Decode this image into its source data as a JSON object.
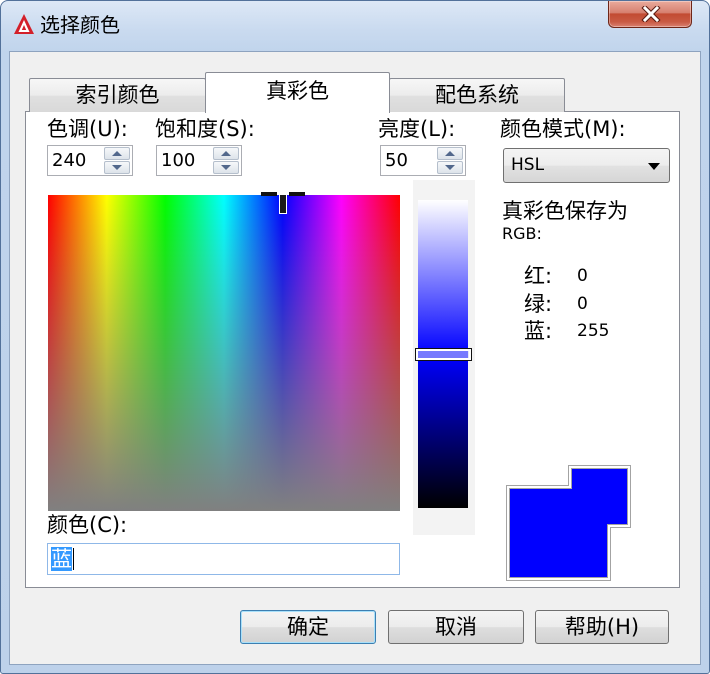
{
  "window": {
    "title": "选择颜色",
    "app_icon": "autocad-logo-icon",
    "close_icon": "close-icon"
  },
  "tabs": [
    {
      "label": "索引颜色",
      "selected": false
    },
    {
      "label": "真彩色",
      "selected": true
    },
    {
      "label": "配色系统",
      "selected": false
    }
  ],
  "true_color": {
    "hue": {
      "label": "色调(U):",
      "value": "240"
    },
    "saturation": {
      "label": "饱和度(S):",
      "value": "100"
    },
    "luminance": {
      "label": "亮度(L):",
      "value": "50"
    },
    "color_model": {
      "label": "颜色模式(M):",
      "selected": "HSL"
    },
    "stored_as": {
      "line1": "真彩色保存为",
      "line2": "RGB:"
    },
    "rgb": [
      {
        "label": "红:",
        "value": "0"
      },
      {
        "label": "绿:",
        "value": "0"
      },
      {
        "label": "蓝:",
        "value": "255"
      }
    ],
    "color_field": {
      "label": "颜色(C):",
      "value": "蓝",
      "text_selected": true
    },
    "preview": {
      "new_color": "#0000ff",
      "original_color": "#0000ff"
    }
  },
  "buttons": {
    "ok": "确定",
    "cancel": "取消",
    "help": "帮助(H)"
  },
  "icons": {
    "spin_up": "spin-up-icon",
    "spin_down": "spin-down-icon",
    "dropdown": "dropdown-arrow-icon",
    "spectrum_marker": "crosshair-marker-icon"
  },
  "colors": {
    "selection": "#3399ff",
    "default_button_border": "#3c7fb1",
    "close_button": "#c75050"
  }
}
